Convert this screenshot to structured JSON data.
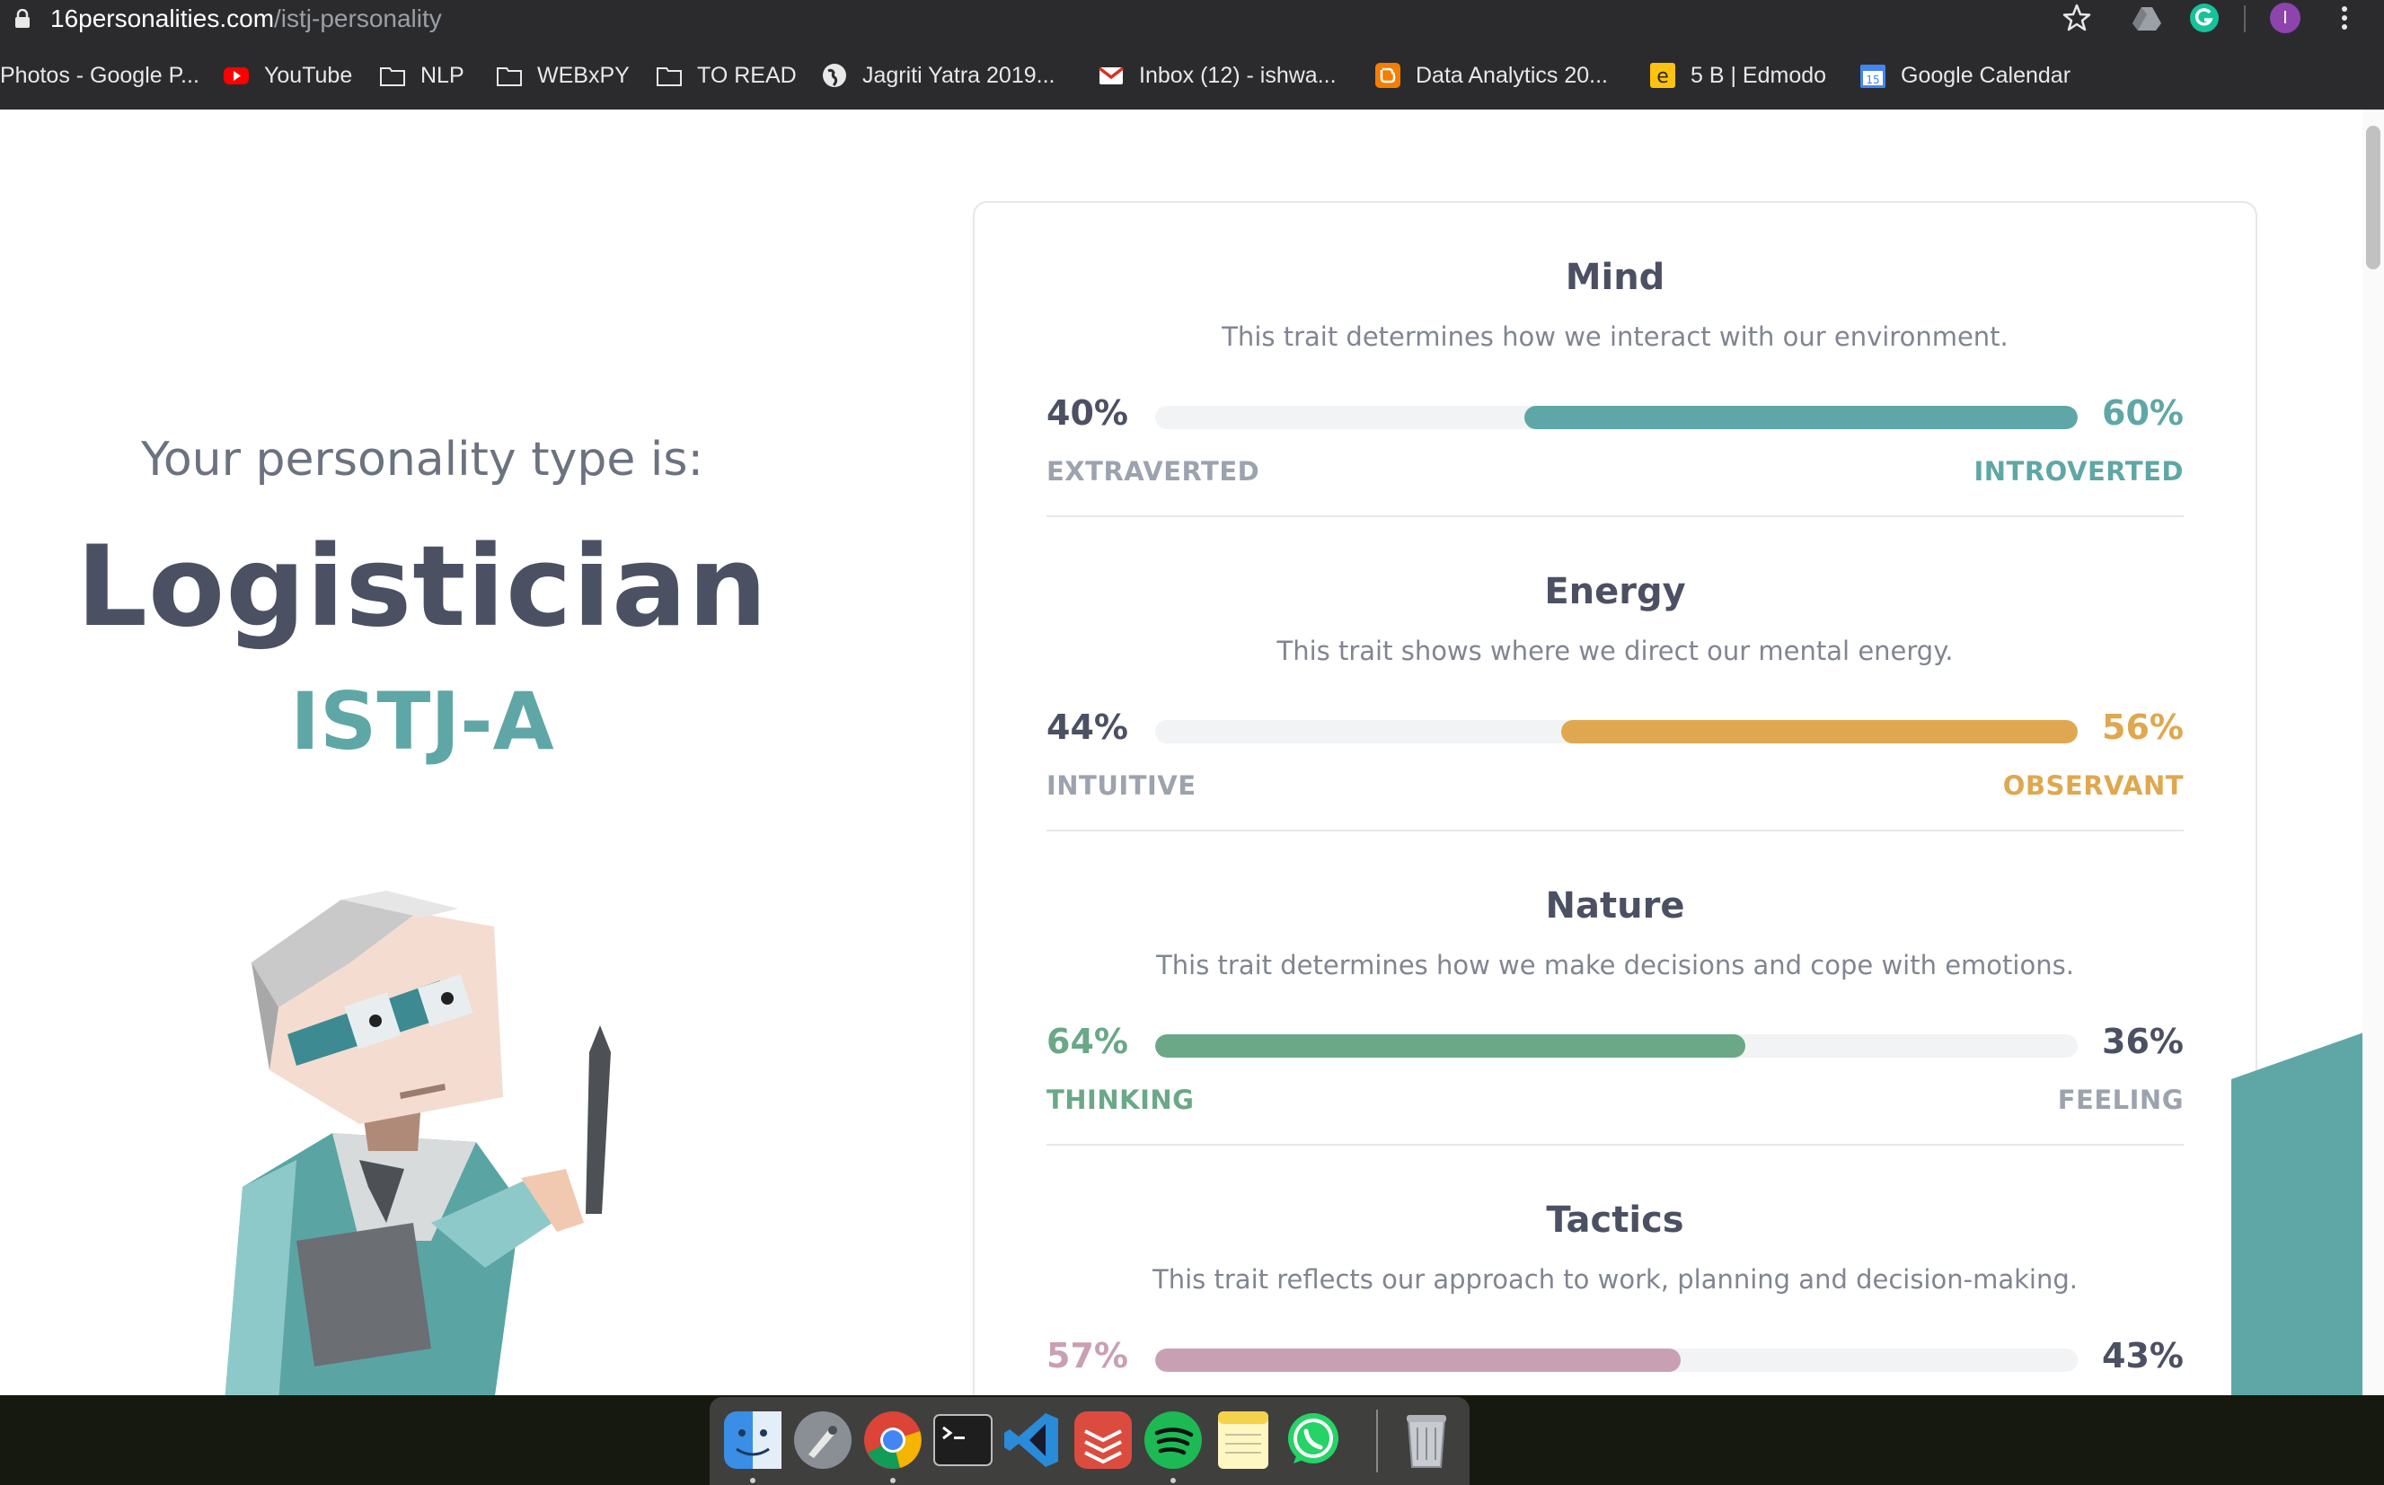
{
  "browser": {
    "url_host": "16personalities.com",
    "url_path": "/istj-personality",
    "profile_initial": "I",
    "bookmarks": [
      {
        "label": "Photos - Google P...",
        "icon": "photos-icon"
      },
      {
        "label": "YouTube",
        "icon": "youtube-icon"
      },
      {
        "label": "NLP",
        "icon": "folder-icon"
      },
      {
        "label": "WEBxPY",
        "icon": "folder-icon"
      },
      {
        "label": "TO READ",
        "icon": "folder-icon"
      },
      {
        "label": "Jagriti Yatra 2019...",
        "icon": "globe-icon"
      },
      {
        "label": "Inbox (12) - ishwa...",
        "icon": "gmail-icon"
      },
      {
        "label": "Data Analytics 20...",
        "icon": "blogger-icon"
      },
      {
        "label": "5 B | Edmodo",
        "icon": "edmodo-icon"
      },
      {
        "label": "Google Calendar",
        "icon": "calendar-icon"
      }
    ]
  },
  "profile": {
    "intro": "Your personality type is:",
    "type_name": "Logistician",
    "type_code": "ISTJ-A"
  },
  "traits": [
    {
      "title": "Mind",
      "description": "This trait determines how we interact with our environment.",
      "left_pct": "40%",
      "right_pct": "60%",
      "left_label": "EXTRAVERTED",
      "right_label": "INTROVERTED",
      "dominant": "right",
      "dominant_share": 0.6,
      "color": "#5fa7a6"
    },
    {
      "title": "Energy",
      "description": "This trait shows where we direct our mental energy.",
      "left_pct": "44%",
      "right_pct": "56%",
      "left_label": "INTUITIVE",
      "right_label": "OBSERVANT",
      "dominant": "right",
      "dominant_share": 0.56,
      "color": "#dfa74f"
    },
    {
      "title": "Nature",
      "description": "This trait determines how we make decisions and cope with emotions.",
      "left_pct": "64%",
      "right_pct": "36%",
      "left_label": "THINKING",
      "right_label": "FEELING",
      "dominant": "left",
      "dominant_share": 0.64,
      "color": "#6aa887"
    },
    {
      "title": "Tactics",
      "description": "This trait reflects our approach to work, planning and decision-making.",
      "left_pct": "57%",
      "right_pct": "43%",
      "left_label": "",
      "right_label": "",
      "dominant": "left",
      "dominant_share": 0.57,
      "color": "#c9a0b3"
    }
  ],
  "colors": {
    "neutral_text": "#4b5063",
    "muted_label": "#9ca3af",
    "teal": "#5fa7a6"
  },
  "dock": {
    "apps": [
      "finder-icon",
      "launchpad-icon",
      "chrome-icon",
      "terminal-icon",
      "vscode-icon",
      "todoist-icon",
      "spotify-icon",
      "notes-icon",
      "whatsapp-icon",
      "trash-icon"
    ]
  }
}
